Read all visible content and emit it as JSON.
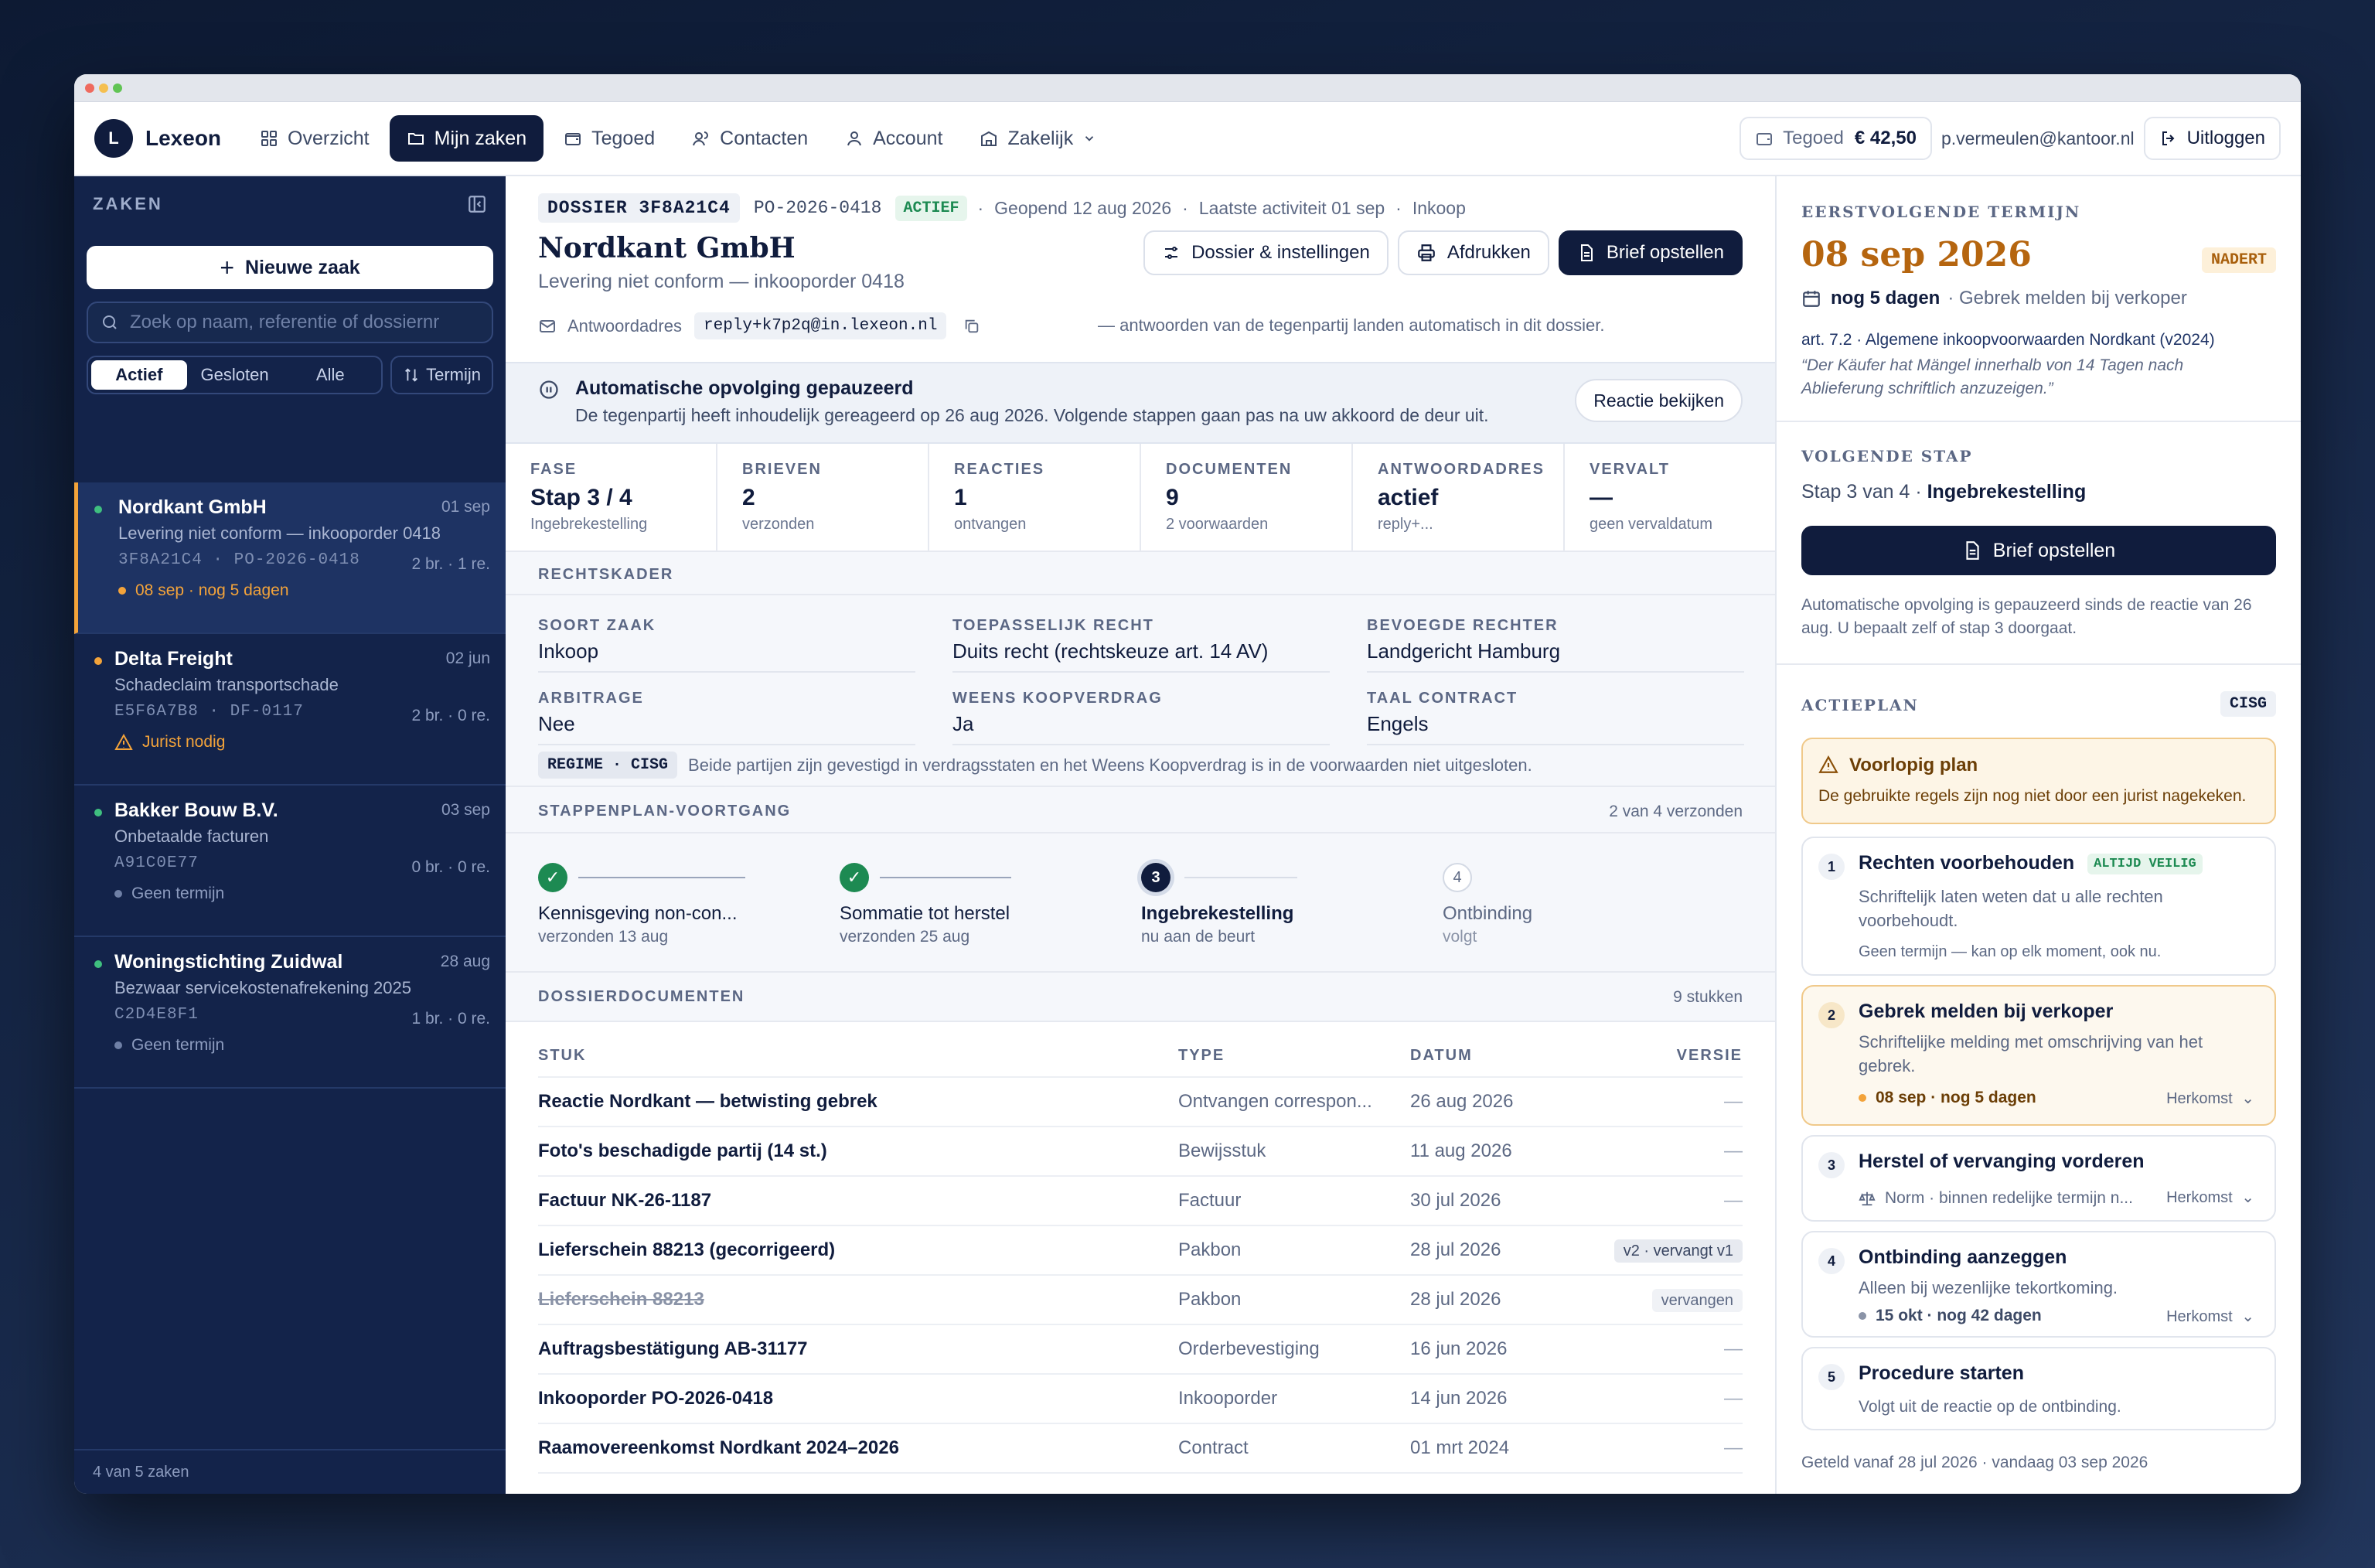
{
  "app": {
    "logo_letter": "L",
    "name": "Lexeon"
  },
  "nav": {
    "items": [
      {
        "label": "Overzicht",
        "icon": "grid-icon"
      },
      {
        "label": "Mijn zaken",
        "icon": "folder-icon"
      },
      {
        "label": "Tegoed",
        "icon": "wallet-icon"
      },
      {
        "label": "Contacten",
        "icon": "contacts-icon"
      },
      {
        "label": "Account",
        "icon": "user-icon"
      },
      {
        "label": "Zakelijk",
        "icon": "building-icon"
      }
    ],
    "credit_label": "Tegoed",
    "credit_value": "€ 42,50",
    "email": "p.vermeulen@kantoor.nl",
    "logout": "Uitloggen"
  },
  "sidebar": {
    "title": "ZAKEN",
    "new_case": "Nieuwe zaak",
    "search_placeholder": "Zoek op naam, referentie of dossiernr",
    "filters": [
      "Actief",
      "Gesloten",
      "Alle"
    ],
    "sort": "Termijn",
    "cases": [
      {
        "name": "Nordkant GmbH",
        "date": "01 sep",
        "subject": "Levering niet conform — inkooporder 0418",
        "ref": "3F8A21C4  ·  PO-2026-0418",
        "count": "2 br. · 1 re.",
        "status": "08 sep · nog 5 dagen"
      },
      {
        "name": "Delta Freight",
        "date": "02 jun",
        "subject": "Schadeclaim transportschade",
        "ref": "E5F6A7B8  ·  DF-0117",
        "count": "2 br. · 0 re.",
        "status": "Jurist nodig"
      },
      {
        "name": "Bakker Bouw B.V.",
        "date": "03 sep",
        "subject": "Onbetaalde facturen",
        "ref": "A91C0E77",
        "count": "0 br. · 0 re.",
        "status": "Geen termijn"
      },
      {
        "name": "Woningstichting Zuidwal",
        "date": "28 aug",
        "subject": "Bezwaar servicekostenafrekening 2025",
        "ref": "C2D4E8F1",
        "count": "1 br. · 0 re.",
        "status": "Geen termijn"
      }
    ],
    "footer": "4 van 5 zaken"
  },
  "dossier": {
    "id": "DOSSIER 3F8A21C4",
    "po": "PO-2026-0418",
    "status": "ACTIEF",
    "opened": "Geopend 12 aug 2026",
    "activity": "Laatste activiteit 01 sep",
    "category": "Inkoop",
    "title": "Nordkant GmbH",
    "subtitle": "Levering niet conform — inkooporder 0418",
    "btn_settings": "Dossier & instellingen",
    "btn_print": "Afdrukken",
    "btn_letter": "Brief opstellen",
    "reply_label": "Antwoordadres",
    "reply_address": "reply+k7p2q@in.lexeon.nl",
    "reply_note": "— antwoorden van de tegenpartij landen automatisch in dit dossier."
  },
  "banner": {
    "title": "Automatische opvolging gepauzeerd",
    "text": "De tegenpartij heeft inhoudelijk gereageerd op 26 aug 2026. Volgende stappen gaan pas na uw akkoord de deur uit.",
    "button": "Reactie bekijken"
  },
  "stats": [
    {
      "label": "FASE",
      "value": "Stap 3 / 4",
      "sub": "Ingebrekestelling"
    },
    {
      "label": "BRIEVEN",
      "value": "2",
      "sub": "verzonden"
    },
    {
      "label": "REACTIES",
      "value": "1",
      "sub": "ontvangen"
    },
    {
      "label": "DOCUMENTEN",
      "value": "9",
      "sub": "2 voorwaarden"
    },
    {
      "label": "ANTWOORDADRES",
      "value": "actief",
      "sub": "reply+..."
    },
    {
      "label": "VERVALT",
      "value": "—",
      "sub": "geen vervaldatum"
    }
  ],
  "legal": {
    "heading": "RECHTSKADER",
    "fields": [
      {
        "label": "SOORT ZAAK",
        "value": "Inkoop"
      },
      {
        "label": "TOEPASSELIJK RECHT",
        "value": "Duits recht (rechtskeuze art. 14 AV)"
      },
      {
        "label": "BEVOEGDE RECHTER",
        "value": "Landgericht Hamburg"
      },
      {
        "label": "ARBITRAGE",
        "value": "Nee"
      },
      {
        "label": "WEENS KOOPVERDRAG",
        "value": "Ja"
      },
      {
        "label": "TAAL CONTRACT",
        "value": "Engels"
      }
    ],
    "regime_tag": "REGIME · CISG",
    "regime_text": "Beide partijen zijn gevestigd in verdragsstaten en het Weens Koopverdrag is in de voorwaarden niet uitgesloten."
  },
  "progress": {
    "heading": "STAPPENPLAN-VOORTGANG",
    "count": "2 van 4 verzonden",
    "steps": [
      {
        "num": "1",
        "title": "Kennisgeving non-con...",
        "sub": "verzonden 13 aug"
      },
      {
        "num": "2",
        "title": "Sommatie tot herstel",
        "sub": "verzonden 25 aug"
      },
      {
        "num": "3",
        "title": "Ingebrekestelling",
        "sub": "nu aan de beurt"
      },
      {
        "num": "4",
        "title": "Ontbinding",
        "sub": "volgt"
      }
    ]
  },
  "documents": {
    "heading": "DOSSIERDOCUMENTEN",
    "count": "9 stukken",
    "columns": [
      "STUK",
      "TYPE",
      "DATUM",
      "VERSIE"
    ],
    "rows": [
      {
        "name": "Reactie Nordkant — betwisting gebrek",
        "type": "Ontvangen correspon...",
        "date": "26 aug 2026",
        "version": "—"
      },
      {
        "name": "Foto's beschadigde partij (14 st.)",
        "type": "Bewijsstuk",
        "date": "11 aug 2026",
        "version": "—"
      },
      {
        "name": "Factuur NK-26-1187",
        "type": "Factuur",
        "date": "30 jul 2026",
        "version": "—"
      },
      {
        "name": "Lieferschein 88213 (gecorrigeerd)",
        "type": "Pakbon",
        "date": "28 jul 2026",
        "version": "v2 · vervangt v1"
      },
      {
        "name": "Lieferschein 88213",
        "type": "Pakbon",
        "date": "28 jul 2026",
        "version": "vervangen"
      },
      {
        "name": "Auftragsbestätigung AB-31177",
        "type": "Orderbevestiging",
        "date": "16 jun 2026",
        "version": "—"
      },
      {
        "name": "Inkooporder PO-2026-0418",
        "type": "Inkooporder",
        "date": "14 jun 2026",
        "version": "—"
      },
      {
        "name": "Raamovereenkomst Nordkant 2024–2026",
        "type": "Contract",
        "date": "01 mrt 2024",
        "version": "—"
      }
    ]
  },
  "right": {
    "deadline_label": "EERSTVOLGENDE TERMIJN",
    "deadline_date": "08 sep 2026",
    "deadline_badge": "NADERT",
    "days_left": "nog 5 dagen",
    "deadline_action": "· Gebrek melden bij verkoper",
    "article": "art. 7.2 · Algemene inkoopvoorwaarden Nordkant (v2024)",
    "quote": "“Der Käufer hat Mängel innerhalb von 14 Tagen nach Ablieferung schriftlich anzuzeigen.”",
    "next_label": "VOLGENDE STAP",
    "next_prefix": "Stap 3 van 4 · ",
    "next_step": "Ingebrekestelling",
    "next_button": "Brief opstellen",
    "next_note": "Automatische opvolging is gepauzeerd sinds de reactie van 26 aug. U bepaalt zelf of stap 3 doorgaat.",
    "plan_label": "ACTIEPLAN",
    "plan_badge": "CISG",
    "warn_title": "Voorlopig plan",
    "warn_text": "De gebruikte regels zijn nog niet door een jurist nagekeken.",
    "plan": [
      {
        "num": "1",
        "title": "Rechten voorbehouden",
        "badge": "ALTIJD VEILIG",
        "desc": "Schriftelijk laten weten dat u alle rechten voorbehoudt.",
        "foot": "Geen termijn — kan op elk moment, ook nu."
      },
      {
        "num": "2",
        "title": "Gebrek melden bij verkoper",
        "desc": "Schriftelijke melding met omschrijving van het gebrek.",
        "foot": "08 sep · nog 5 dagen",
        "origin": "Herkomst"
      },
      {
        "num": "3",
        "title": "Herstel of vervanging vorderen",
        "foot": "Norm · binnen redelijke termijn n...",
        "origin": "Herkomst"
      },
      {
        "num": "4",
        "title": "Ontbinding aanzeggen",
        "desc": "Alleen bij wezenlijke tekortkoming.",
        "foot": "15 okt · nog 42 dagen",
        "origin": "Herkomst"
      },
      {
        "num": "5",
        "title": "Procedure starten",
        "desc": "Volgt uit de reactie op de ontbinding."
      }
    ],
    "footer": "Geteld vanaf 28 jul 2026 · vandaag 03 sep 2026"
  }
}
